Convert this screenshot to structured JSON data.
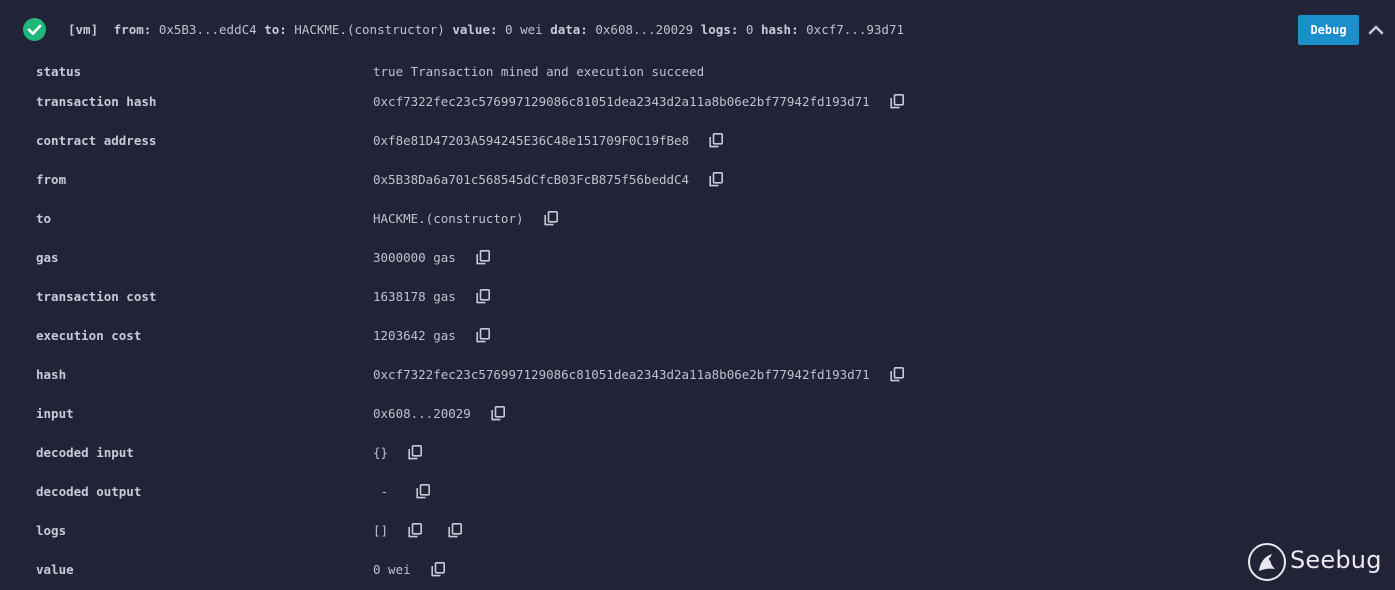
{
  "header": {
    "status_icon": "check-circle-icon",
    "tag": "[vm]",
    "from_label": "from:",
    "from_value": "0x5B3...eddC4",
    "to_label": "to:",
    "to_value": "HACKME.(constructor)",
    "value_label": "value:",
    "value_value": "0 wei",
    "data_label": "data:",
    "data_value": "0x608...20029",
    "logs_label": "logs:",
    "logs_value": "0",
    "hash_label": "hash:",
    "hash_value": "0xcf7...93d71",
    "debug_label": "Debug",
    "collapse_icon": "chevron-up-icon"
  },
  "details": {
    "status": {
      "label": "status",
      "value": "true Transaction mined and execution succeed"
    },
    "transaction_hash": {
      "label": "transaction hash",
      "value": "0xcf7322fec23c576997129086c81051dea2343d2a11a8b06e2bf77942fd193d71"
    },
    "contract_address": {
      "label": "contract address",
      "value": "0xf8e81D47203A594245E36C48e151709F0C19fBe8"
    },
    "from": {
      "label": "from",
      "value": "0x5B38Da6a701c568545dCfcB03FcB875f56beddC4"
    },
    "to": {
      "label": "to",
      "value": "HACKME.(constructor)"
    },
    "gas": {
      "label": "gas",
      "value": "3000000 gas"
    },
    "transaction_cost": {
      "label": "transaction cost",
      "value": "1638178 gas"
    },
    "execution_cost": {
      "label": "execution cost",
      "value": "1203642 gas"
    },
    "hash": {
      "label": "hash",
      "value": "0xcf7322fec23c576997129086c81051dea2343d2a11a8b06e2bf77942fd193d71"
    },
    "input": {
      "label": "input",
      "value": "0x608...20029"
    },
    "decoded_input": {
      "label": "decoded input",
      "value": "{}"
    },
    "decoded_output": {
      "label": "decoded output",
      "value": " - "
    },
    "logs": {
      "label": "logs",
      "value": "[]"
    },
    "value": {
      "label": "value",
      "value": "0 wei"
    }
  },
  "copy_icon": "copy-icon",
  "watermark": {
    "brand": "Seebug",
    "icon": "seebug-logo-icon"
  }
}
